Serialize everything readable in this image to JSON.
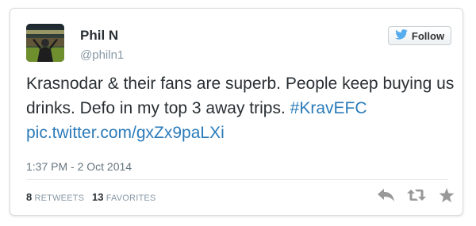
{
  "tweet": {
    "display_name": "Phil N",
    "handle": "@philn1",
    "follow_label": "Follow",
    "text_main": "Krasnodar & their fans are superb. People keep buying us drinks. Defo in my top 3 away trips.",
    "hashtag": "#KravEFC",
    "pic_link": "pic.twitter.com/gxZx9paLXi",
    "timestamp": "1:37 PM - 2 Oct 2014"
  },
  "stats": {
    "retweets_count": "8",
    "retweets_label": "RETWEETS",
    "favorites_count": "13",
    "favorites_label": "FAVORITES"
  },
  "colors": {
    "link": "#2b7bb9",
    "twitter_bird": "#55acee",
    "action_icons": "#999999"
  },
  "icons": [
    "twitter-bird-icon",
    "reply-icon",
    "retweet-icon",
    "favorite-star-icon"
  ]
}
